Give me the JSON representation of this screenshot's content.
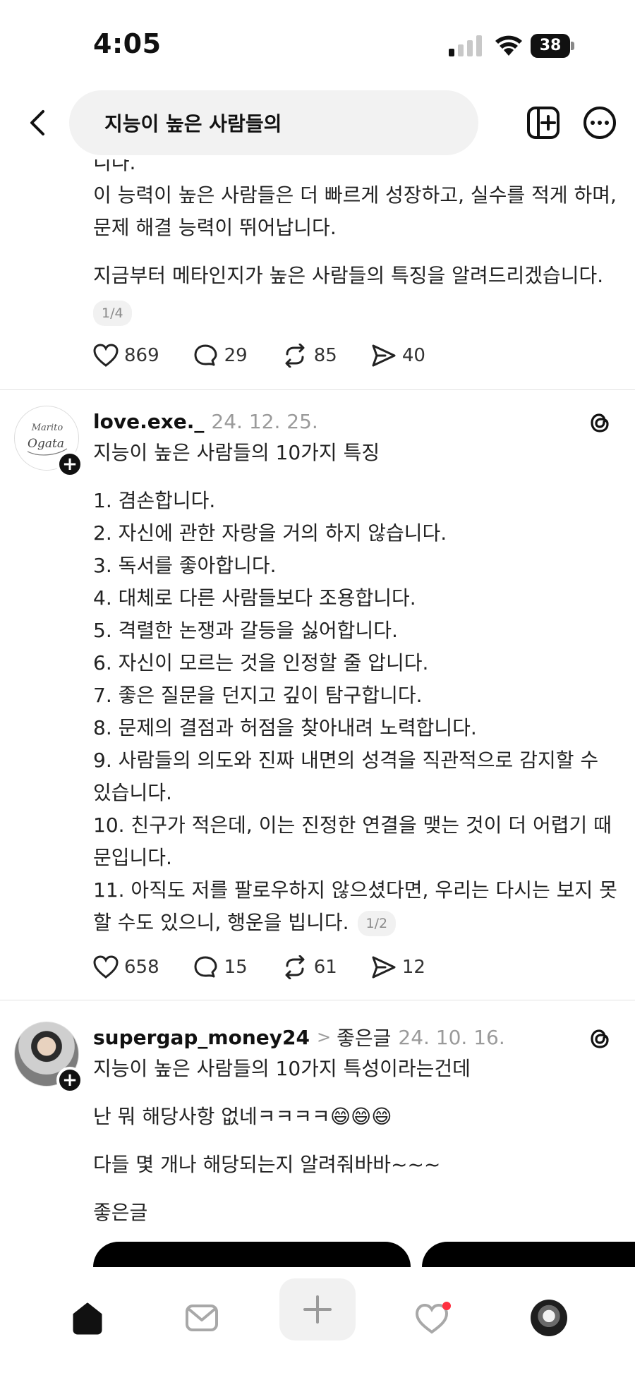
{
  "status_bar": {
    "time": "4:05",
    "battery": "38",
    "icons": [
      "cellular-signal-icon",
      "wifi-icon",
      "battery-icon"
    ]
  },
  "header": {
    "search_text": "지능이 높은 사람들의",
    "icons": [
      "back-arrow-icon",
      "new-post-icon",
      "more-icon"
    ]
  },
  "posts": [
    {
      "paragraphs": [
        "니다.\n이 능력이 높은 사람들은 더 빠르게 성장하고, 실수를 적게 하며, 문제 해결 능력이 뛰어납니다.",
        "지금부터 메타인지가 높은 사람들의 특징을 알려드리겠습니다."
      ],
      "page_indicator": "1/4",
      "likes": "869",
      "comments": "29",
      "reposts": "85",
      "shares": "40"
    },
    {
      "username": "love.exe._",
      "date": "24. 12. 25.",
      "avatar_text": "Marito Ogata",
      "title": "지능이 높은 사람들의 10가지 특징",
      "list": [
        "1. 겸손합니다.",
        "2. 자신에 관한 자랑을 거의 하지 않습니다.",
        "3. 독서를 좋아합니다.",
        "4. 대체로 다른 사람들보다 조용합니다.",
        "5. 격렬한 논쟁과 갈등을 싫어합니다.",
        "6. 자신이 모르는 것을 인정할 줄 압니다.",
        "7. 좋은 질문을 던지고 깊이 탐구합니다.",
        "8. 문제의 결점과 허점을 찾아내려 노력합니다.",
        "9. 사람들의 의도와 진짜 내면의 성격을 직관적으로 감지할 수 있습니다.",
        "10. 친구가 적은데, 이는 진정한 연결을 맺는 것이 더 어렵기 때문입니다.",
        "11. 아직도 저를 팔로우하지 않으셨다면, 우리는 다시는 보지 못할 수도 있으니, 행운을 빕니다."
      ],
      "page_indicator": "1/2",
      "likes": "658",
      "comments": "15",
      "reposts": "61",
      "shares": "12"
    },
    {
      "username": "supergap_money24",
      "topic_separator": ">",
      "topic": "좋은글",
      "date": "24. 10. 16.",
      "lines": [
        "지능이 높은 사람들의 10가지 특성이라는건데",
        "난 뭐 해당사항 없네ㅋㅋㅋㅋ😄😄😄",
        "다들 몇 개나 해당되는지 알려줘바바~~~",
        "좋은글"
      ]
    }
  ],
  "bottom_nav": {
    "items": [
      "home-icon",
      "inbox-icon",
      "compose-icon",
      "activity-icon",
      "profile-avatar"
    ],
    "activity_badge_color": "#ff3040"
  }
}
